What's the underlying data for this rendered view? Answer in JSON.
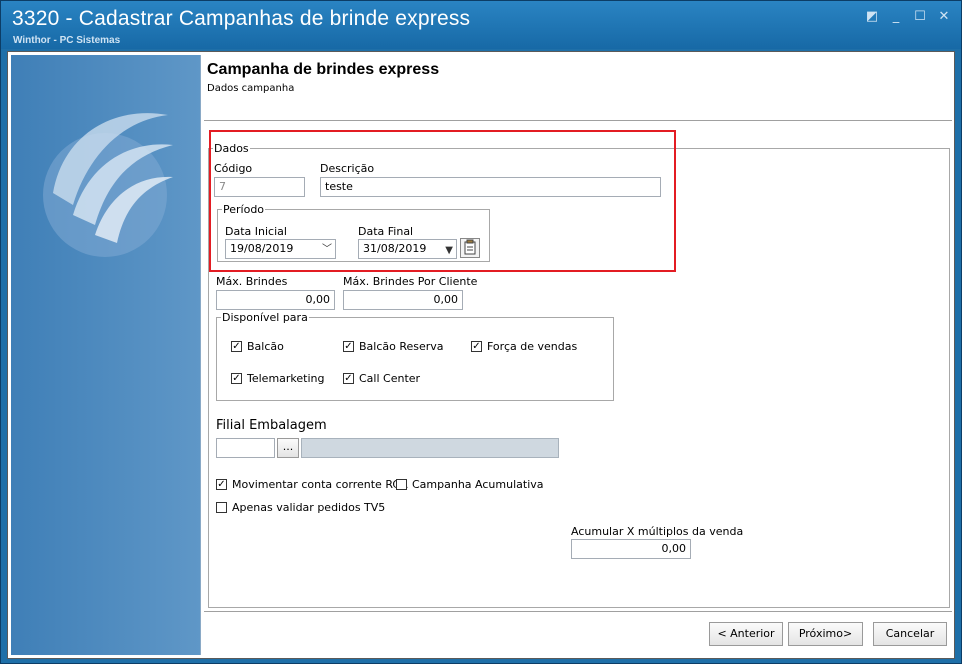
{
  "window": {
    "title": "3320 - Cadastrar Campanhas de brinde express",
    "subtitle": "Winthor - PC Sistemas"
  },
  "header": {
    "title": "Campanha de brindes express",
    "subtitle": "Dados campanha"
  },
  "dados": {
    "legend": "Dados",
    "codigo_label": "Código",
    "codigo_value": "7",
    "descricao_label": "Descrição",
    "descricao_value": "teste",
    "periodo": {
      "legend": "Período",
      "data_inicial_label": "Data Inicial",
      "data_inicial_value": "19/08/2019",
      "data_final_label": "Data Final",
      "data_final_value": "31/08/2019"
    }
  },
  "limits": {
    "max_brindes_label": "Máx. Brindes",
    "max_brindes_value": "0,00",
    "max_por_cliente_label": "Máx. Brindes Por Cliente",
    "max_por_cliente_value": "0,00"
  },
  "disponivel": {
    "legend": "Disponível para",
    "items": [
      {
        "label": "Balcão",
        "checked": true
      },
      {
        "label": "Balcão Reserva",
        "checked": true
      },
      {
        "label": "Força de vendas",
        "checked": true
      },
      {
        "label": "Telemarketing",
        "checked": true
      },
      {
        "label": "Call Center",
        "checked": true
      }
    ]
  },
  "filial": {
    "label": "Filial Embalagem",
    "code_value": "",
    "browse_label": "...",
    "name_value": ""
  },
  "options": {
    "movimentar_label": "Movimentar conta corrente RCA",
    "movimentar_checked": true,
    "acumulativa_label": "Campanha Acumulativa",
    "acumulativa_checked": false,
    "apenas_label": "Apenas validar pedidos TV5",
    "apenas_checked": false
  },
  "acumular": {
    "label": "Acumular X múltiplos da venda",
    "value": "0,00"
  },
  "buttons": {
    "anterior": "< Anterior",
    "proximo": "Próximo>",
    "cancelar": "Cancelar"
  },
  "colors": {
    "highlight": "#e31c23",
    "titlebar": "#1769a6"
  }
}
